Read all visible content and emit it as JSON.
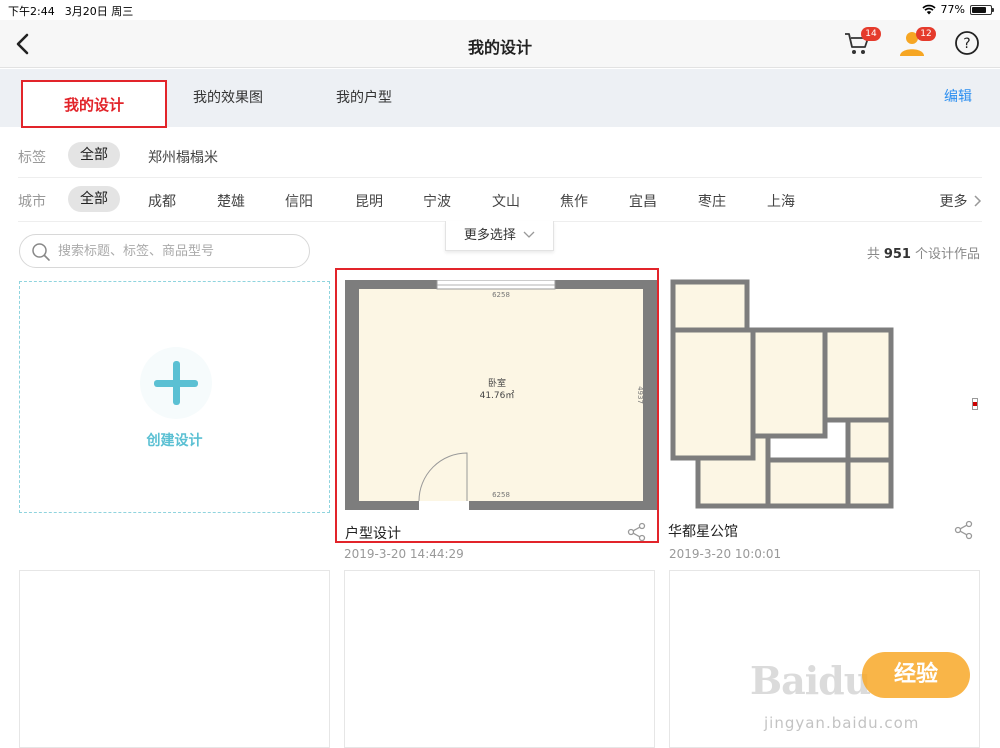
{
  "status_bar": {
    "time": "下午2:44",
    "date": "3月20日 周三",
    "battery": "77%",
    "battery_level": 0.77
  },
  "nav": {
    "title": "我的设计",
    "cart_badge": "14",
    "user_badge": "12"
  },
  "tabs": {
    "items": [
      "我的设计",
      "我的效果图",
      "我的户型"
    ],
    "active_index": 0,
    "edit_label": "编辑"
  },
  "filters": {
    "tag_label": "标签",
    "tags": [
      "全部",
      "郑州榻榻米"
    ],
    "city_label": "城市",
    "cities": [
      "全部",
      "成都",
      "楚雄",
      "信阳",
      "昆明",
      "宁波",
      "文山",
      "焦作",
      "宜昌",
      "枣庄",
      "上海"
    ],
    "more_label": "更多",
    "more_select_label": "更多选择"
  },
  "search": {
    "placeholder": "搜索标题、标签、商品型号"
  },
  "count": {
    "prefix": "共",
    "number": "951",
    "suffix": "个设计作品"
  },
  "create": {
    "label": "创建设计"
  },
  "designs": [
    {
      "name": "户型设计",
      "date": "2019-3-20 14:44:29",
      "room_label": "卧室",
      "room_area": "41.76㎡",
      "dim_top": "6258",
      "dim_bottom": "6258",
      "dim_side": "4937"
    },
    {
      "name": "华都星公馆",
      "date": "2019-3-20 10:0:01"
    }
  ],
  "watermark": {
    "brand": "Baidu",
    "badge": "经验",
    "url": "jingyan.baidu.com"
  },
  "colors": {
    "accent_red": "#e2242a",
    "link_blue": "#2b8ef0",
    "create_cyan": "#5bc0d3"
  }
}
